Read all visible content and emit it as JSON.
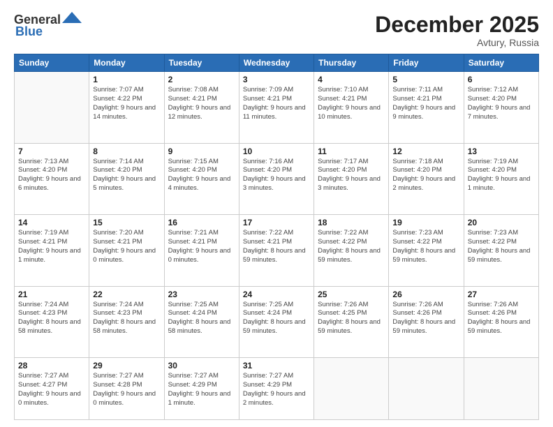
{
  "header": {
    "logo_line1": "General",
    "logo_line2": "Blue",
    "month": "December 2025",
    "location": "Avtury, Russia"
  },
  "weekdays": [
    "Sunday",
    "Monday",
    "Tuesday",
    "Wednesday",
    "Thursday",
    "Friday",
    "Saturday"
  ],
  "weeks": [
    [
      {
        "day": "",
        "sunrise": "",
        "sunset": "",
        "daylight": ""
      },
      {
        "day": "1",
        "sunrise": "Sunrise: 7:07 AM",
        "sunset": "Sunset: 4:22 PM",
        "daylight": "Daylight: 9 hours and 14 minutes."
      },
      {
        "day": "2",
        "sunrise": "Sunrise: 7:08 AM",
        "sunset": "Sunset: 4:21 PM",
        "daylight": "Daylight: 9 hours and 12 minutes."
      },
      {
        "day": "3",
        "sunrise": "Sunrise: 7:09 AM",
        "sunset": "Sunset: 4:21 PM",
        "daylight": "Daylight: 9 hours and 11 minutes."
      },
      {
        "day": "4",
        "sunrise": "Sunrise: 7:10 AM",
        "sunset": "Sunset: 4:21 PM",
        "daylight": "Daylight: 9 hours and 10 minutes."
      },
      {
        "day": "5",
        "sunrise": "Sunrise: 7:11 AM",
        "sunset": "Sunset: 4:21 PM",
        "daylight": "Daylight: 9 hours and 9 minutes."
      },
      {
        "day": "6",
        "sunrise": "Sunrise: 7:12 AM",
        "sunset": "Sunset: 4:20 PM",
        "daylight": "Daylight: 9 hours and 7 minutes."
      }
    ],
    [
      {
        "day": "7",
        "sunrise": "Sunrise: 7:13 AM",
        "sunset": "Sunset: 4:20 PM",
        "daylight": "Daylight: 9 hours and 6 minutes."
      },
      {
        "day": "8",
        "sunrise": "Sunrise: 7:14 AM",
        "sunset": "Sunset: 4:20 PM",
        "daylight": "Daylight: 9 hours and 5 minutes."
      },
      {
        "day": "9",
        "sunrise": "Sunrise: 7:15 AM",
        "sunset": "Sunset: 4:20 PM",
        "daylight": "Daylight: 9 hours and 4 minutes."
      },
      {
        "day": "10",
        "sunrise": "Sunrise: 7:16 AM",
        "sunset": "Sunset: 4:20 PM",
        "daylight": "Daylight: 9 hours and 3 minutes."
      },
      {
        "day": "11",
        "sunrise": "Sunrise: 7:17 AM",
        "sunset": "Sunset: 4:20 PM",
        "daylight": "Daylight: 9 hours and 3 minutes."
      },
      {
        "day": "12",
        "sunrise": "Sunrise: 7:18 AM",
        "sunset": "Sunset: 4:20 PM",
        "daylight": "Daylight: 9 hours and 2 minutes."
      },
      {
        "day": "13",
        "sunrise": "Sunrise: 7:19 AM",
        "sunset": "Sunset: 4:20 PM",
        "daylight": "Daylight: 9 hours and 1 minute."
      }
    ],
    [
      {
        "day": "14",
        "sunrise": "Sunrise: 7:19 AM",
        "sunset": "Sunset: 4:21 PM",
        "daylight": "Daylight: 9 hours and 1 minute."
      },
      {
        "day": "15",
        "sunrise": "Sunrise: 7:20 AM",
        "sunset": "Sunset: 4:21 PM",
        "daylight": "Daylight: 9 hours and 0 minutes."
      },
      {
        "day": "16",
        "sunrise": "Sunrise: 7:21 AM",
        "sunset": "Sunset: 4:21 PM",
        "daylight": "Daylight: 9 hours and 0 minutes."
      },
      {
        "day": "17",
        "sunrise": "Sunrise: 7:22 AM",
        "sunset": "Sunset: 4:21 PM",
        "daylight": "Daylight: 8 hours and 59 minutes."
      },
      {
        "day": "18",
        "sunrise": "Sunrise: 7:22 AM",
        "sunset": "Sunset: 4:22 PM",
        "daylight": "Daylight: 8 hours and 59 minutes."
      },
      {
        "day": "19",
        "sunrise": "Sunrise: 7:23 AM",
        "sunset": "Sunset: 4:22 PM",
        "daylight": "Daylight: 8 hours and 59 minutes."
      },
      {
        "day": "20",
        "sunrise": "Sunrise: 7:23 AM",
        "sunset": "Sunset: 4:22 PM",
        "daylight": "Daylight: 8 hours and 59 minutes."
      }
    ],
    [
      {
        "day": "21",
        "sunrise": "Sunrise: 7:24 AM",
        "sunset": "Sunset: 4:23 PM",
        "daylight": "Daylight: 8 hours and 58 minutes."
      },
      {
        "day": "22",
        "sunrise": "Sunrise: 7:24 AM",
        "sunset": "Sunset: 4:23 PM",
        "daylight": "Daylight: 8 hours and 58 minutes."
      },
      {
        "day": "23",
        "sunrise": "Sunrise: 7:25 AM",
        "sunset": "Sunset: 4:24 PM",
        "daylight": "Daylight: 8 hours and 58 minutes."
      },
      {
        "day": "24",
        "sunrise": "Sunrise: 7:25 AM",
        "sunset": "Sunset: 4:24 PM",
        "daylight": "Daylight: 8 hours and 59 minutes."
      },
      {
        "day": "25",
        "sunrise": "Sunrise: 7:26 AM",
        "sunset": "Sunset: 4:25 PM",
        "daylight": "Daylight: 8 hours and 59 minutes."
      },
      {
        "day": "26",
        "sunrise": "Sunrise: 7:26 AM",
        "sunset": "Sunset: 4:26 PM",
        "daylight": "Daylight: 8 hours and 59 minutes."
      },
      {
        "day": "27",
        "sunrise": "Sunrise: 7:26 AM",
        "sunset": "Sunset: 4:26 PM",
        "daylight": "Daylight: 8 hours and 59 minutes."
      }
    ],
    [
      {
        "day": "28",
        "sunrise": "Sunrise: 7:27 AM",
        "sunset": "Sunset: 4:27 PM",
        "daylight": "Daylight: 9 hours and 0 minutes."
      },
      {
        "day": "29",
        "sunrise": "Sunrise: 7:27 AM",
        "sunset": "Sunset: 4:28 PM",
        "daylight": "Daylight: 9 hours and 0 minutes."
      },
      {
        "day": "30",
        "sunrise": "Sunrise: 7:27 AM",
        "sunset": "Sunset: 4:29 PM",
        "daylight": "Daylight: 9 hours and 1 minute."
      },
      {
        "day": "31",
        "sunrise": "Sunrise: 7:27 AM",
        "sunset": "Sunset: 4:29 PM",
        "daylight": "Daylight: 9 hours and 2 minutes."
      },
      {
        "day": "",
        "sunrise": "",
        "sunset": "",
        "daylight": ""
      },
      {
        "day": "",
        "sunrise": "",
        "sunset": "",
        "daylight": ""
      },
      {
        "day": "",
        "sunrise": "",
        "sunset": "",
        "daylight": ""
      }
    ]
  ]
}
